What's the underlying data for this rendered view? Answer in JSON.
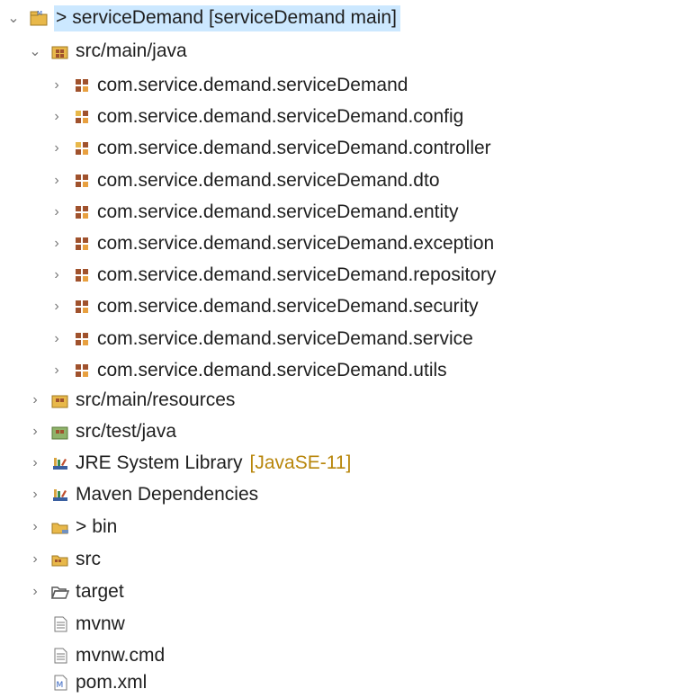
{
  "project": {
    "prefix": ">",
    "label": "serviceDemand [serviceDemand main]"
  },
  "source_folder": {
    "label": "src/main/java"
  },
  "packages": [
    "com.service.demand.serviceDemand",
    "com.service.demand.serviceDemand.config",
    "com.service.demand.serviceDemand.controller",
    "com.service.demand.serviceDemand.dto",
    "com.service.demand.serviceDemand.entity",
    "com.service.demand.serviceDemand.exception",
    "com.service.demand.serviceDemand.repository",
    "com.service.demand.serviceDemand.security",
    "com.service.demand.serviceDemand.service",
    "com.service.demand.serviceDemand.utils"
  ],
  "items": {
    "resources": "src/main/resources",
    "test_java": "src/test/java",
    "jre": "JRE System Library",
    "jre_qualifier": "[JavaSE-11]",
    "maven": "Maven Dependencies",
    "bin_prefix": ">",
    "bin": "bin",
    "src": "src",
    "target": "target",
    "mvnw": "mvnw",
    "mvnw_cmd": "mvnw.cmd",
    "pom": "pom.xml"
  },
  "colors": {
    "selection": "#cce8ff",
    "qualifier": "#b8860b",
    "package_brown": "#a0522d",
    "folder_yellow": "#e8b84a"
  },
  "icons": {
    "project": "maven-project-icon",
    "source_folder": "source-folder-icon",
    "package": "package-icon",
    "library": "library-icon",
    "folder": "folder-icon",
    "file": "file-icon",
    "xml": "maven-pom-icon"
  }
}
